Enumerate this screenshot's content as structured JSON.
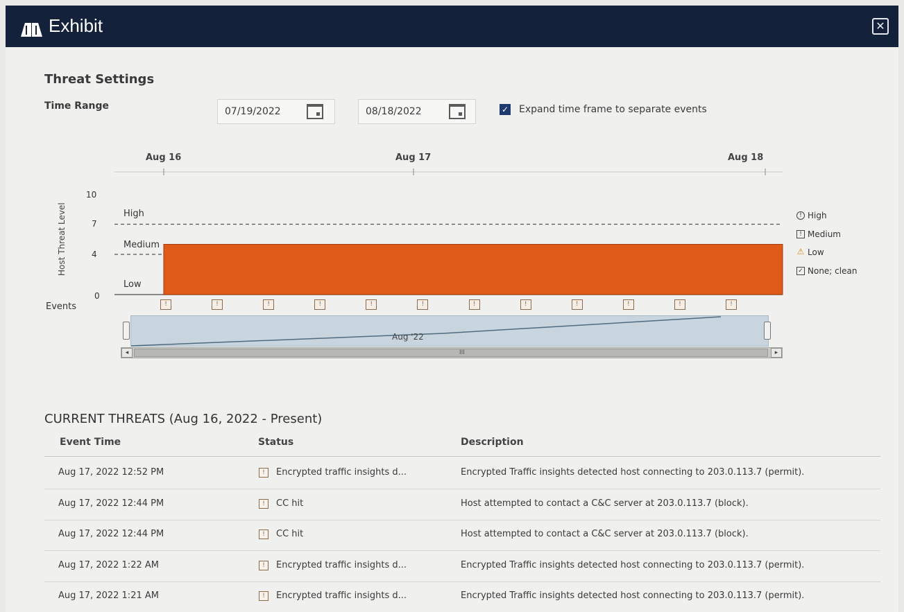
{
  "window": {
    "title": "Exhibit",
    "logo_icon": "exhibit-book-icon",
    "close_icon": "close-x-icon"
  },
  "threat_settings": {
    "title": "Threat Settings",
    "time_range_label": "Time Range",
    "start_date": "07/19/2022",
    "end_date": "08/18/2022",
    "calendar_icon": "calendar-icon",
    "expand_checked": true,
    "expand_label": "Expand time frame to separate events"
  },
  "chart_data": {
    "type": "area",
    "x_axis_labels": [
      "Aug 16",
      "Aug 17",
      "Aug 18"
    ],
    "y_label": "Host Threat Level",
    "y_ticks": [
      0,
      4,
      7,
      10
    ],
    "ylim": [
      0,
      10
    ],
    "bands": [
      {
        "name": "High",
        "from": 7,
        "to": 10
      },
      {
        "name": "Medium",
        "from": 4,
        "to": 7
      },
      {
        "name": "Low",
        "from": 0,
        "to": 4
      }
    ],
    "series": [
      {
        "x_start": "Aug 16",
        "x_end": "Aug 18",
        "level": 5,
        "color": "#e05a17"
      }
    ],
    "legend": [
      {
        "label": "High",
        "icon": "high-circle-icon"
      },
      {
        "label": "Medium",
        "icon": "medium-square-icon"
      },
      {
        "label": "Low",
        "icon": "low-triangle-icon"
      },
      {
        "label": "None; clean",
        "icon": "none-check-icon"
      }
    ],
    "events_label": "Events",
    "event_count": 12,
    "navigator_label": "Aug '22",
    "scroll_grip": "III"
  },
  "threats": {
    "title": "CURRENT THREATS (Aug 16, 2022 - Present)",
    "columns": [
      "Event Time",
      "Status",
      "Description"
    ],
    "rows": [
      {
        "time": "Aug 17, 2022 12:52 PM",
        "status": "Encrypted traffic insights d...",
        "description": "Encrypted Traffic insights detected host connecting to 203.0.113.7 (permit)."
      },
      {
        "time": "Aug 17, 2022 12:44 PM",
        "status": "CC hit",
        "description": "Host attempted to contact a C&C server at 203.0.113.7 (block)."
      },
      {
        "time": "Aug 17, 2022 12:44 PM",
        "status": "CC hit",
        "description": "Host attempted to contact a C&C server at 203.0.113.7 (block)."
      },
      {
        "time": "Aug 17, 2022 1:22 AM",
        "status": "Encrypted traffic insights d...",
        "description": "Encrypted Traffic insights detected host connecting to 203.0.113.7 (permit)."
      },
      {
        "time": "Aug 17, 2022 1:21 AM",
        "status": "Encrypted traffic insights d...",
        "description": "Encrypted Traffic insights detected host connecting to 203.0.113.7 (permit)."
      }
    ]
  },
  "colors": {
    "titlebar": "#13213a",
    "threat_fill": "#e05a17",
    "navigator": "#c8d4de"
  }
}
